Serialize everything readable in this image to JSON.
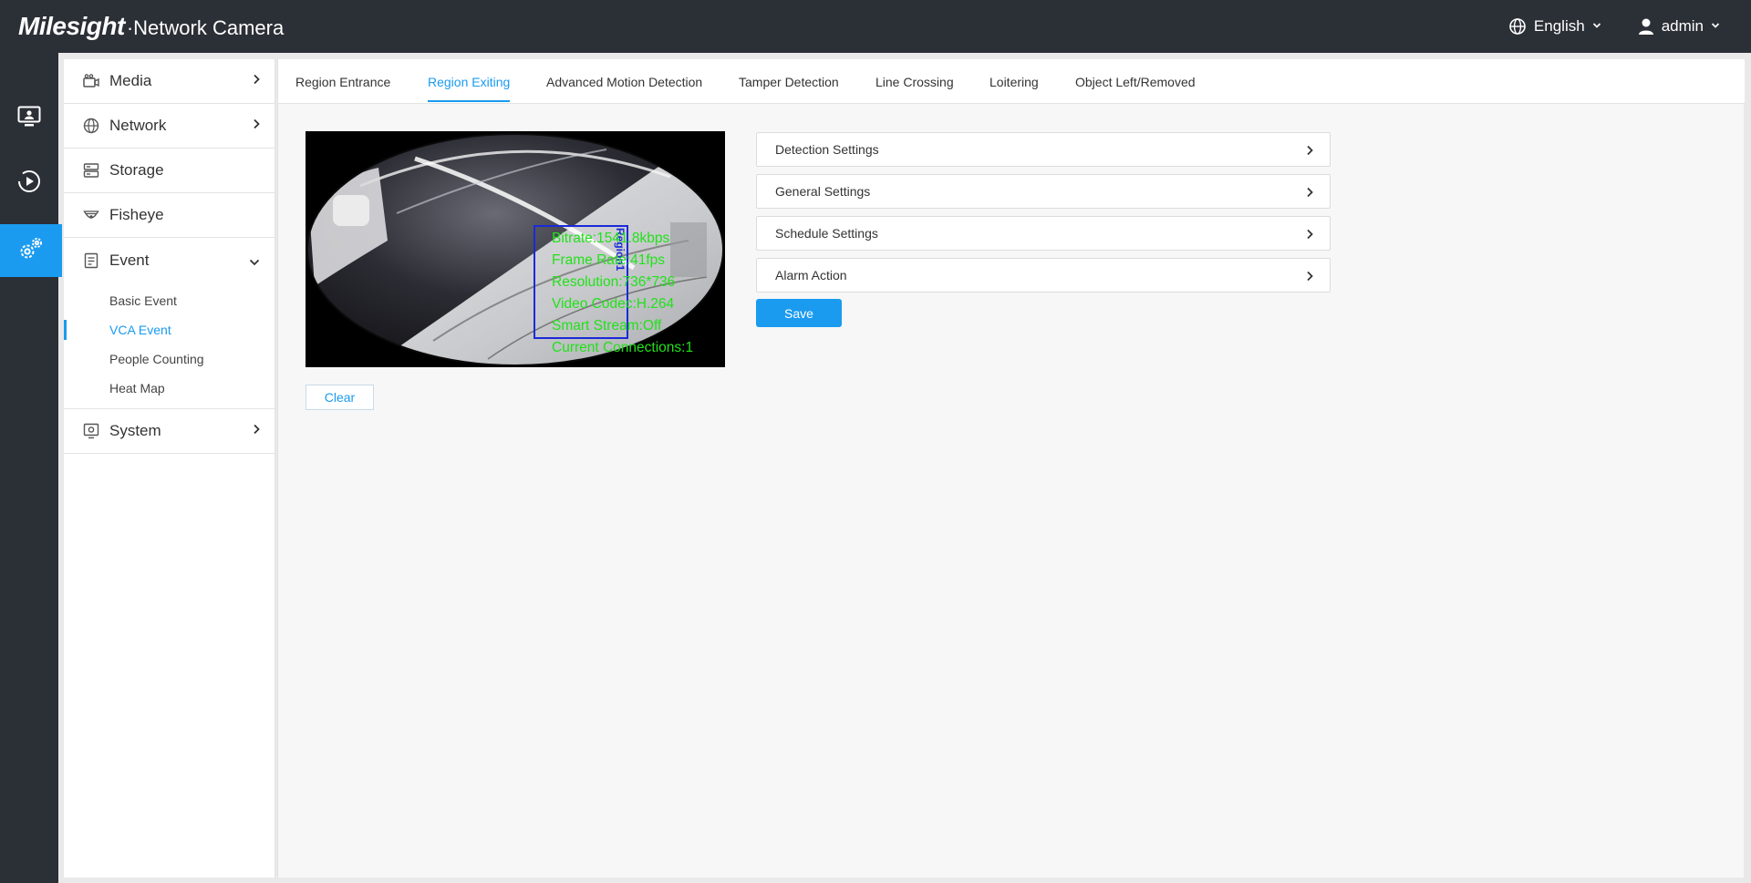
{
  "header": {
    "brand": "Milesight",
    "brand_dot": "·",
    "product": "Network Camera",
    "language": "English",
    "user": "admin"
  },
  "rail": {
    "items": [
      {
        "icon": "live-view-icon"
      },
      {
        "icon": "playback-icon"
      },
      {
        "icon": "settings-icon",
        "active": true
      }
    ]
  },
  "menu": {
    "media": "Media",
    "network": "Network",
    "storage": "Storage",
    "fisheye": "Fisheye",
    "event": "Event",
    "event_sub": [
      "Basic Event",
      "VCA Event",
      "People Counting",
      "Heat Map"
    ],
    "active_sub": "VCA Event",
    "system": "System"
  },
  "tabs": {
    "items": [
      "Region Entrance",
      "Region Exiting",
      "Advanced Motion Detection",
      "Tamper Detection",
      "Line Crossing",
      "Loitering",
      "Object Left/Removed"
    ],
    "active": "Region Exiting"
  },
  "video": {
    "osd": [
      "Bitrate:1541.8kbps",
      "Frame Rate:41fps",
      "Resolution:736*736",
      "Video Codec:H.264",
      "Smart Stream:Off",
      "Current Connections:1"
    ],
    "region_label": "Region1"
  },
  "buttons": {
    "clear": "Clear",
    "save": "Save"
  },
  "sections": {
    "detection": "Detection Settings",
    "general": "General Settings",
    "schedule": "Schedule Settings",
    "alarm": "Alarm Action"
  },
  "colors": {
    "header_bg": "#2b2f36",
    "accent": "#1a9bf0",
    "osd_text": "#21e21a",
    "region_box": "#1a2ad8"
  }
}
